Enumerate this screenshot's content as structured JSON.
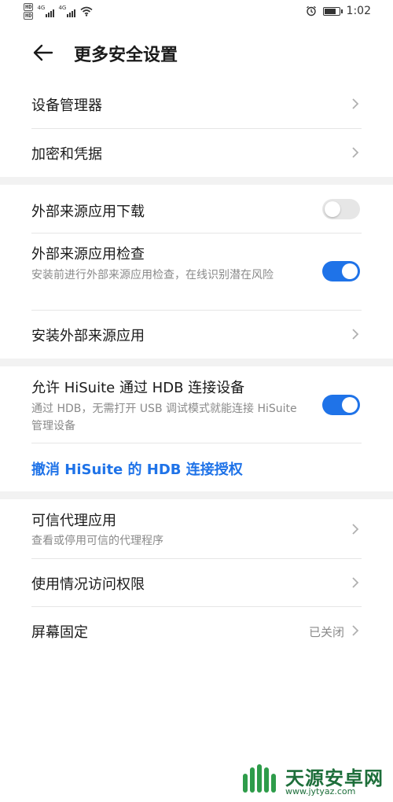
{
  "status_bar": {
    "hd1": "HD",
    "hd2": "HD",
    "net1": "4G",
    "net2": "4G",
    "time": "1:02",
    "battery_level": 0.85
  },
  "header": {
    "title": "更多安全设置"
  },
  "section1": {
    "device_manager": "设备管理器",
    "encryption": "加密和凭据"
  },
  "section2": {
    "external_download": {
      "label": "外部来源应用下载",
      "enabled": false
    },
    "external_check": {
      "label": "外部来源应用检查",
      "desc": "安装前进行外部来源应用检查，在线识别潜在风险",
      "enabled": true
    },
    "install_external": "安装外部来源应用"
  },
  "section3": {
    "hisuite_hdb": {
      "label": "允许 HiSuite 通过 HDB 连接设备",
      "desc": "通过 HDB，无需打开 USB 调试模式就能连接 HiSuite 管理设备",
      "enabled": true
    },
    "revoke_link": "撤消 HiSuite 的 HDB 连接授权"
  },
  "section4": {
    "trusted_agents": {
      "label": "可信代理应用",
      "desc": "查看或停用可信的代理程序"
    },
    "usage_access": "使用情况访问权限",
    "screen_pinning": {
      "label": "屏幕固定",
      "value": "已关闭"
    }
  },
  "watermark": {
    "title": "天源安卓网",
    "url": "www.jytyaz.com"
  },
  "colors": {
    "accent": "#1f73e8",
    "toggle_off": "#e6e6e6",
    "section_gap": "#f2f2f2"
  }
}
